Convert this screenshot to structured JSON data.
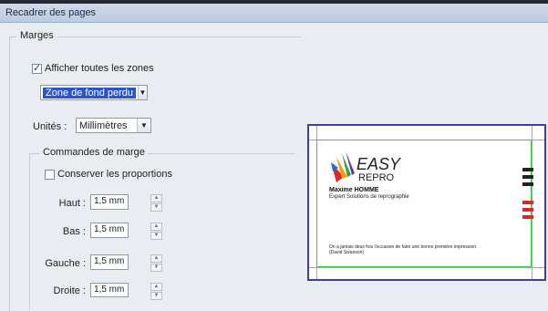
{
  "window": {
    "title": "Recadrer des pages"
  },
  "margins": {
    "legend": "Marges",
    "show_all_label": "Afficher toutes les zones",
    "show_all_checked": true,
    "zone_selected": "Zone de fond perdu",
    "units_label": "Unités :",
    "units_value": "Millimètres"
  },
  "margin_controls": {
    "legend": "Commandes de marge",
    "keep_proportions_label": "Conserver les proportions",
    "keep_proportions_checked": false,
    "fields": [
      {
        "label": "Haut :",
        "value": "1,5 mm"
      },
      {
        "label": "Bas :",
        "value": "1,5 mm"
      },
      {
        "label": "Gauche :",
        "value": "1,5 mm"
      },
      {
        "label": "Droite :",
        "value": "1,5 mm"
      }
    ]
  },
  "preview": {
    "logo_text_1": "EASY",
    "logo_text_2": "REPRO",
    "name": "Maxime HOMME",
    "role": "Expert Solutions de reprographie",
    "quote_1": "On a jamais deux fois l'occasion de faire une bonne première impression.",
    "quote_2": "(David Swanson)",
    "swatch_colors": [
      "#222222",
      "#222222",
      "#222222",
      "#d62828",
      "#d62828",
      "#d62828"
    ]
  }
}
